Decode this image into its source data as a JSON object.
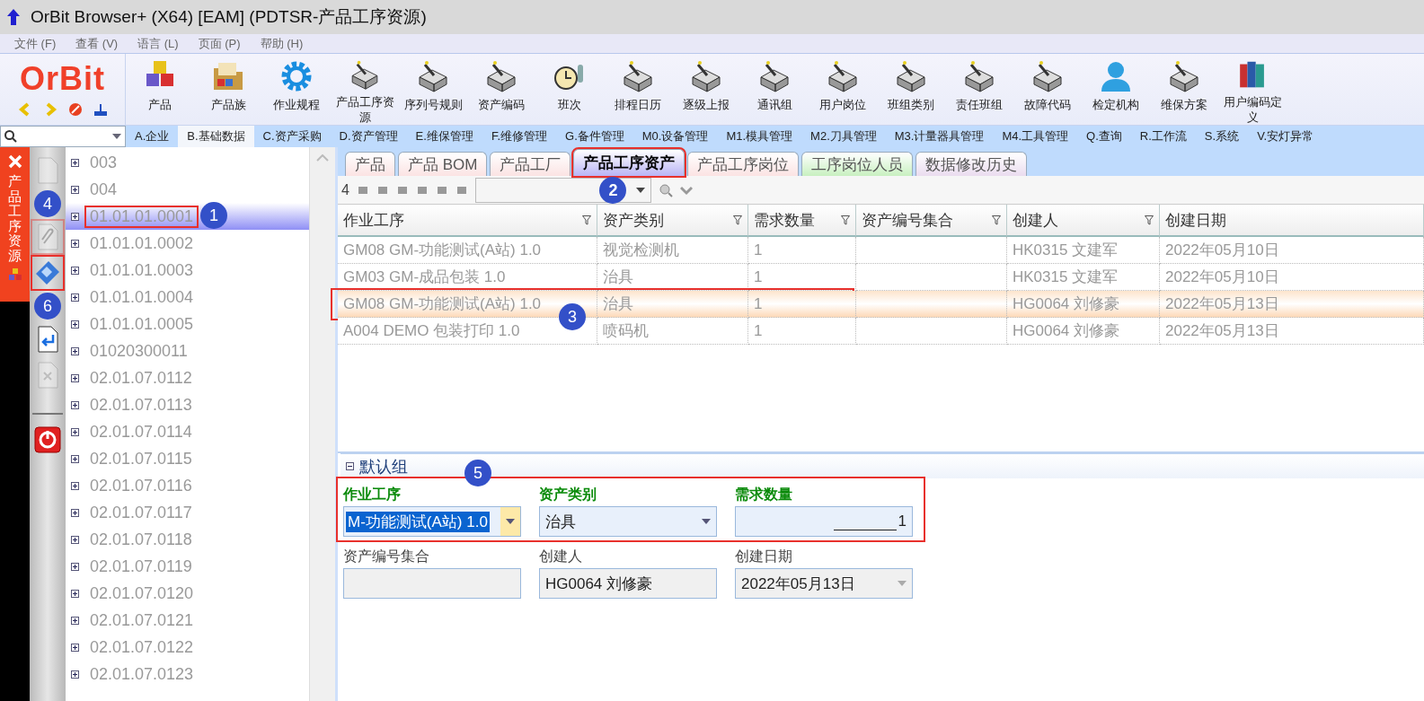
{
  "window": {
    "title": "OrBit Browser+ (X64) [EAM] (PDTSR-产品工序资源)"
  },
  "menu": [
    "文件 (F)",
    "查看 (V)",
    "语言 (L)",
    "页面 (P)",
    "帮助 (H)"
  ],
  "logo": {
    "text": "OrBit"
  },
  "toolbar": [
    {
      "label": "产品",
      "kind": "cubes"
    },
    {
      "label": "产品族",
      "kind": "folder"
    },
    {
      "label": "作业规程",
      "kind": "gear"
    },
    {
      "label": "产品工序资源",
      "kind": "tray"
    },
    {
      "label": "序列号规则",
      "kind": "tray"
    },
    {
      "label": "资产编码",
      "kind": "tray"
    },
    {
      "label": "班次",
      "kind": "clock"
    },
    {
      "label": "排程日历",
      "kind": "tray"
    },
    {
      "label": "逐级上报",
      "kind": "tray"
    },
    {
      "label": "通讯组",
      "kind": "tray"
    },
    {
      "label": "用户岗位",
      "kind": "tray"
    },
    {
      "label": "班组类别",
      "kind": "tray"
    },
    {
      "label": "责任班组",
      "kind": "tray"
    },
    {
      "label": "故障代码",
      "kind": "tray"
    },
    {
      "label": "检定机构",
      "kind": "person"
    },
    {
      "label": "维保方案",
      "kind": "tray"
    },
    {
      "label": "用户编码定义",
      "kind": "books"
    }
  ],
  "module_tabs": [
    {
      "label": "A.企业",
      "selected": false
    },
    {
      "label": "B.基础数据",
      "selected": true
    },
    {
      "label": "C.资产采购",
      "selected": false
    },
    {
      "label": "D.资产管理",
      "selected": false
    },
    {
      "label": "E.维保管理",
      "selected": false
    },
    {
      "label": "F.维修管理",
      "selected": false
    },
    {
      "label": "G.备件管理",
      "selected": false
    },
    {
      "label": "M0.设备管理",
      "selected": false
    },
    {
      "label": "M1.模具管理",
      "selected": false
    },
    {
      "label": "M2.刀具管理",
      "selected": false
    },
    {
      "label": "M3.计量器具管理",
      "selected": false
    },
    {
      "label": "M4.工具管理",
      "selected": false
    },
    {
      "label": "Q.查询",
      "selected": false
    },
    {
      "label": "R.工作流",
      "selected": false
    },
    {
      "label": "S.系统",
      "selected": false
    },
    {
      "label": "V.安灯异常",
      "selected": false
    }
  ],
  "side_panel": {
    "title": "产品工序资源"
  },
  "side_tools": [
    {
      "kind": "document",
      "disabled": true
    },
    {
      "kind": "paperclip",
      "disabled": true,
      "marker": "4"
    },
    {
      "kind": "blueprint",
      "disabled": false,
      "marker": "6"
    },
    {
      "kind": "return",
      "disabled": false
    },
    {
      "kind": "delete",
      "disabled": true
    },
    {
      "kind": "power",
      "disabled": false
    }
  ],
  "tree": {
    "items": [
      {
        "label": "003",
        "selected": false
      },
      {
        "label": "004",
        "selected": false
      },
      {
        "label": "01.01.01.0001",
        "selected": true,
        "marker": "1"
      },
      {
        "label": "01.01.01.0002",
        "selected": false
      },
      {
        "label": "01.01.01.0003",
        "selected": false
      },
      {
        "label": "01.01.01.0004",
        "selected": false
      },
      {
        "label": "01.01.01.0005",
        "selected": false
      },
      {
        "label": "01020300011",
        "selected": false
      },
      {
        "label": "02.01.07.0112",
        "selected": false
      },
      {
        "label": "02.01.07.0113",
        "selected": false
      },
      {
        "label": "02.01.07.0114",
        "selected": false
      },
      {
        "label": "02.01.07.0115",
        "selected": false
      },
      {
        "label": "02.01.07.0116",
        "selected": false
      },
      {
        "label": "02.01.07.0117",
        "selected": false
      },
      {
        "label": "02.01.07.0118",
        "selected": false
      },
      {
        "label": "02.01.07.0119",
        "selected": false
      },
      {
        "label": "02.01.07.0120",
        "selected": false
      },
      {
        "label": "02.01.07.0121",
        "selected": false
      },
      {
        "label": "02.01.07.0122",
        "selected": false
      },
      {
        "label": "02.01.07.0123",
        "selected": false
      }
    ]
  },
  "tabs": [
    {
      "label": "产品",
      "selected": false,
      "color": "#fbe3e3"
    },
    {
      "label": "产品 BOM",
      "selected": false,
      "color": "#fbe3e3"
    },
    {
      "label": "产品工厂",
      "selected": false,
      "color": "#fbe3e3"
    },
    {
      "label": "产品工序资产",
      "selected": true,
      "color": "#b9b4f5",
      "marker": "2"
    },
    {
      "label": "产品工序岗位",
      "selected": false,
      "color": "#fbe3e3"
    },
    {
      "label": "工序岗位人员",
      "selected": false,
      "color": "#c8f0c0"
    },
    {
      "label": "数据修改历史",
      "selected": false,
      "color": "#eadcef"
    }
  ],
  "grid": {
    "count": "4",
    "columns": [
      {
        "label": "作业工序",
        "filter": true
      },
      {
        "label": "资产类别",
        "filter": true
      },
      {
        "label": "需求数量",
        "filter": true
      },
      {
        "label": "资产编号集合",
        "filter": true
      },
      {
        "label": "创建人",
        "filter": true
      },
      {
        "label": "创建日期",
        "filter": false
      }
    ],
    "rows": [
      {
        "cells": [
          "GM08  GM-功能测试(A站) 1.0",
          "视觉检测机",
          "1",
          "",
          "HK0315 文建军",
          "2022年05月10日"
        ],
        "selected": false
      },
      {
        "cells": [
          "GM03  GM-成品包装 1.0",
          "治具",
          "1",
          "",
          "HK0315 文建军",
          "2022年05月10日"
        ],
        "selected": false
      },
      {
        "cells": [
          "GM08  GM-功能测试(A站) 1.0",
          "治具",
          "1",
          "",
          "HG0064 刘修豪",
          "2022年05月13日"
        ],
        "selected": true,
        "marker": "3"
      },
      {
        "cells": [
          "A004 DEMO 包装打印 1.0",
          "喷码机",
          "1",
          "",
          "HG0064 刘修豪",
          "2022年05月13日"
        ],
        "selected": false
      }
    ]
  },
  "form": {
    "group": "默认组",
    "marker": "5",
    "rows": [
      [
        {
          "label": "作业工序",
          "value": "M-功能测试(A站) 1.0",
          "kind": "combo",
          "required": true,
          "focused": true
        },
        {
          "label": "资产类别",
          "value": "治具",
          "kind": "combo",
          "required": true
        },
        {
          "label": "需求数量",
          "value": "1",
          "kind": "number",
          "required": true
        }
      ],
      [
        {
          "label": "资产编号集合",
          "kind": "text",
          "required": false
        },
        {
          "label": "创建人",
          "value": "HG0064 刘修豪",
          "kind": "text",
          "required": false
        },
        {
          "label": "创建日期",
          "value": "2022年05月13日",
          "kind": "date",
          "required": false
        }
      ]
    ]
  }
}
